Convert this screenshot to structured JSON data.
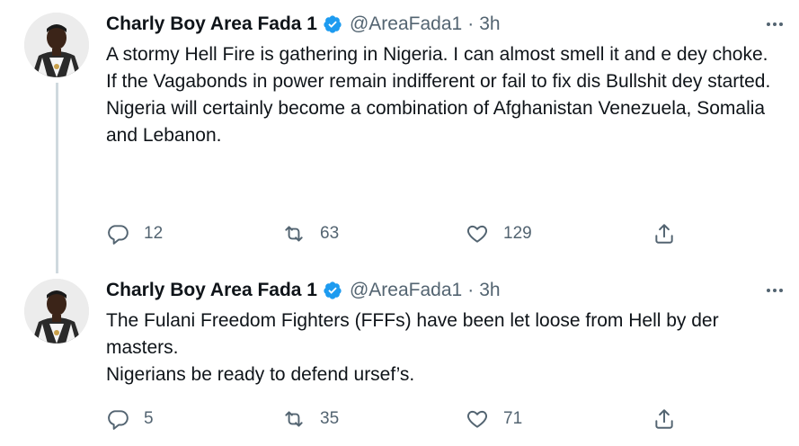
{
  "tweets": [
    {
      "author": {
        "name": "Charly Boy Area Fada 1",
        "handle": "@AreaFada1",
        "separator": "·",
        "time": "3h"
      },
      "body_lines": [
        "A stormy Hell Fire is gathering in Nigeria. I can almost smell it and e dey choke.",
        "If the Vagabonds in power remain indifferent or fail to fix dis Bullshit dey started.",
        "Nigeria will certainly become a combination of Afghanistan Venezuela, Somalia and Lebanon."
      ],
      "stats": {
        "replies": "12",
        "retweets": "63",
        "likes": "129"
      }
    },
    {
      "author": {
        "name": "Charly Boy Area Fada 1",
        "handle": "@AreaFada1",
        "separator": "·",
        "time": "3h"
      },
      "body_lines": [
        "The Fulani Freedom Fighters (FFFs) have been let loose from Hell by der masters.",
        "Nigerians be ready to defend ursef’s."
      ],
      "stats": {
        "replies": "5",
        "retweets": "35",
        "likes": "71"
      }
    }
  ],
  "icons": {
    "verified": "verified-badge-icon",
    "more": "more-horizontal-icon",
    "reply": "reply-icon",
    "retweet": "retweet-icon",
    "like": "heart-icon",
    "share": "share-icon"
  },
  "colors": {
    "text": "#0f1419",
    "secondary": "#536471",
    "verified": "#1d9bf0",
    "thread_line": "#cfd9de"
  }
}
